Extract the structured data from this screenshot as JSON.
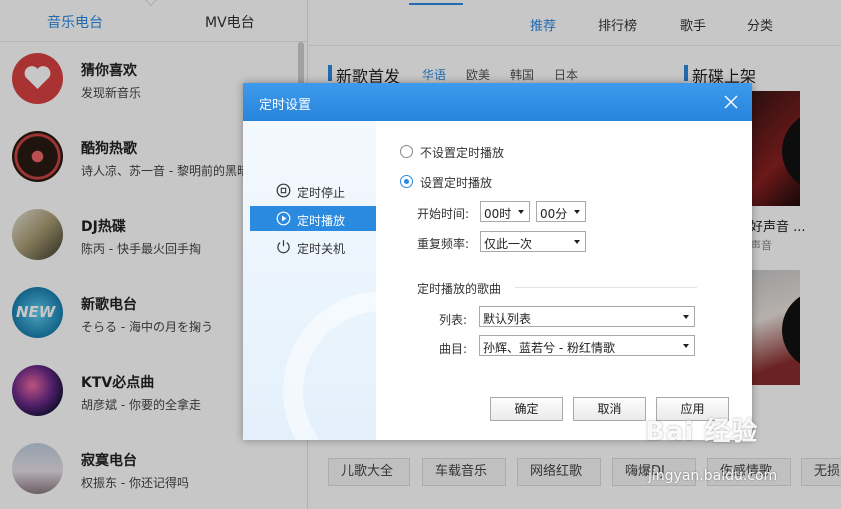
{
  "left_panel": {
    "tabs": [
      "音乐电台",
      "MV电台"
    ],
    "stations": [
      {
        "name": "猜你喜欢",
        "sub": "发现新音乐"
      },
      {
        "name": "酷狗热歌",
        "sub": "诗人凉、苏一音 - 黎明前的黑暗"
      },
      {
        "name": "DJ热碟",
        "sub": "陈丙 - 快手最火回手掏"
      },
      {
        "name": "新歌电台",
        "sub": "そらる - 海中の月を掬う"
      },
      {
        "name": "KTV必点曲",
        "sub": "胡彦斌 - 你要的全拿走"
      },
      {
        "name": "寂寞电台",
        "sub": "权振东 - 你还记得吗"
      }
    ],
    "new_badge": "NEW"
  },
  "right_panel": {
    "nav_tabs": [
      "推荐",
      "排行榜",
      "歌手",
      "分类"
    ],
    "new_songs_title": "新歌首发",
    "languages": [
      "华语",
      "欧美",
      "韩国",
      "日本"
    ],
    "new_albums_title": "新碟上架",
    "album_1_title": "好声音 ...",
    "album_1_sub": "声音",
    "tags": [
      "儿歌大全",
      "车载音乐",
      "网络红歌",
      "嗨爆DJ",
      "伤感情歌",
      "无损"
    ]
  },
  "dialog": {
    "title": "定时设置",
    "side_items": [
      "定时停止",
      "定时播放",
      "定时关机"
    ],
    "radio_options": [
      "不设置定时播放",
      "设置定时播放"
    ],
    "start_label": "开始时间:",
    "hour": "00时",
    "minute": "00分",
    "repeat_label": "重复频率:",
    "repeat_value": "仅此一次",
    "section_title": "定时播放的歌曲",
    "list_label": "列表:",
    "list_value": "默认列表",
    "song_label": "曲目:",
    "song_value": "孙辉、蓝若兮 - 粉红情歌",
    "buttons": [
      "确定",
      "取消",
      "应用"
    ]
  },
  "watermark": {
    "logo": "Bai 经验",
    "url": "jingyan.baidu.com"
  },
  "colors": {
    "accent": "#2a8ae0",
    "dialog_header": "#2784db"
  }
}
